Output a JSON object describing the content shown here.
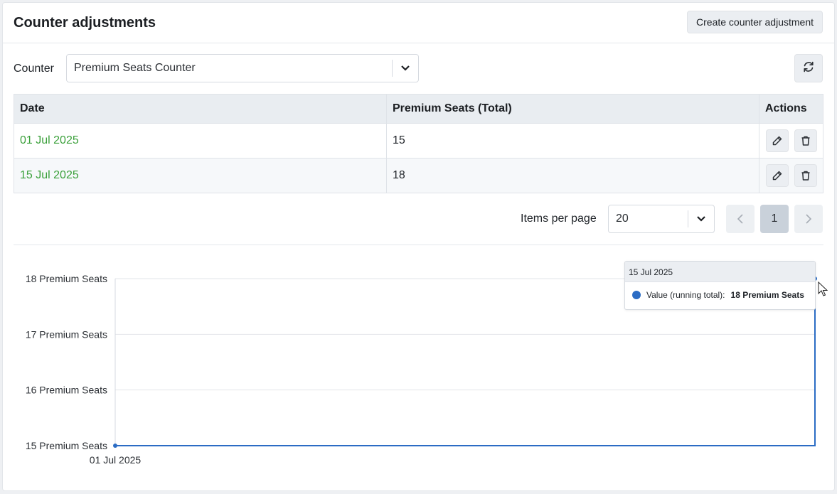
{
  "header": {
    "title": "Counter adjustments",
    "create_button": "Create counter adjustment"
  },
  "filter": {
    "label": "Counter",
    "selected": "Premium Seats Counter",
    "refresh_icon": "refresh-icon"
  },
  "table": {
    "columns": [
      "Date",
      "Premium Seats (Total)",
      "Actions"
    ],
    "rows": [
      {
        "date": "01 Jul 2025",
        "value": "15"
      },
      {
        "date": "15 Jul 2025",
        "value": "18"
      }
    ]
  },
  "pagination": {
    "items_per_page_label": "Items per page",
    "items_per_page": "20",
    "current_page": "1"
  },
  "colors": {
    "accent_date": "#3aa03a",
    "series": "#2b6cc4"
  },
  "chart_data": {
    "type": "line",
    "x": [
      "01 Jul 2025",
      "15 Jul 2025"
    ],
    "x_tick_labels": [
      "01 Jul 2025"
    ],
    "series": [
      {
        "name": "Value (running total)",
        "values": [
          15,
          18
        ]
      }
    ],
    "y_ticks": [
      "18 Premium Seats",
      "17 Premium Seats",
      "16 Premium Seats",
      "15 Premium Seats"
    ],
    "ylim": [
      15,
      18
    ],
    "step": true,
    "grid": true
  },
  "tooltip": {
    "date": "15 Jul 2025",
    "label": "Value (running total):",
    "value": "18 Premium Seats"
  }
}
